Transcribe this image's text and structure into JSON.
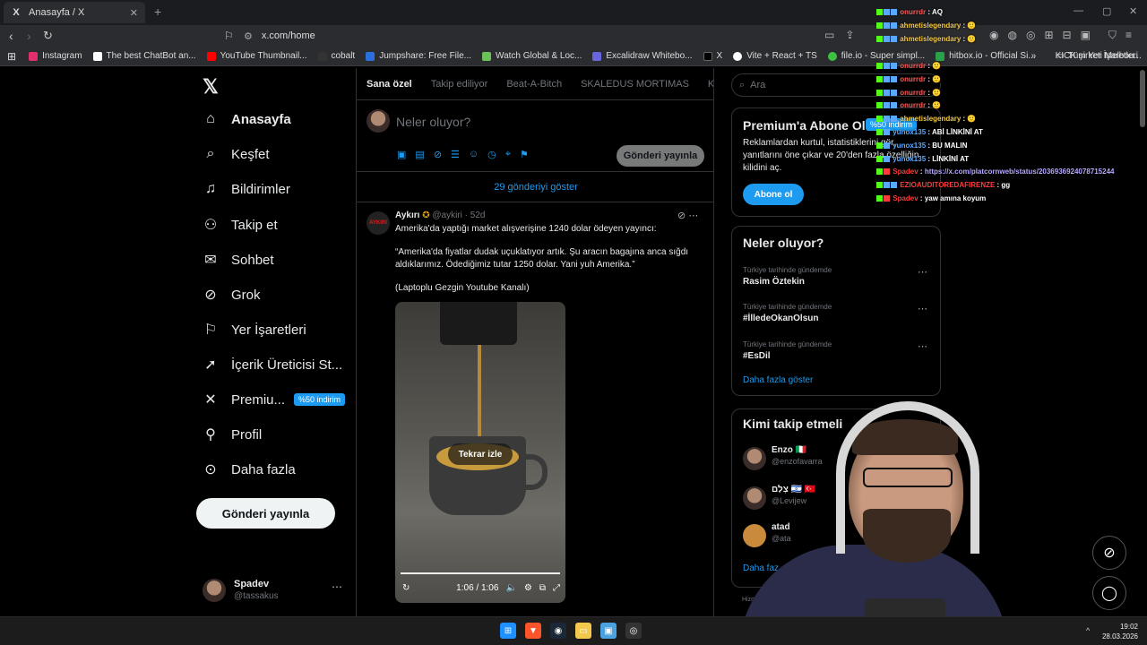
{
  "browser": {
    "tab_title": "Anasayfa / X",
    "tab_icon": "X",
    "url": "x.com/home",
    "bookmarks": [
      {
        "label": "Instagram",
        "color": "#e1306c"
      },
      {
        "label": "The best ChatBot an...",
        "color": "#ffffff"
      },
      {
        "label": "YouTube Thumbnail...",
        "color": "#ff0000"
      },
      {
        "label": "cobalt",
        "color": "#333333"
      },
      {
        "label": "Jumpshare: Free File...",
        "color": "#2a6fdb"
      },
      {
        "label": "Watch Global & Loc...",
        "color": "#6ac259"
      },
      {
        "label": "Excalidraw Whitebo...",
        "color": "#6965db"
      },
      {
        "label": "X",
        "color": "#000000"
      },
      {
        "label": "Vite + React + TS",
        "color": "#ffffff"
      },
      {
        "label": "file.io - Super simpl...",
        "color": "#3fbf3f"
      },
      {
        "label": "hitbox.io - Official Si...",
        "color": "#2aa04a"
      },
      {
        "label": "KICK şirketi Melbou...",
        "color": "#53fc18"
      }
    ],
    "all_bookmarks": "Tüm Yer İşaretleri"
  },
  "sidebar": {
    "items": [
      {
        "label": "Anasayfa",
        "icon": "⌂"
      },
      {
        "label": "Keşfet",
        "icon": "⌕"
      },
      {
        "label": "Bildirimler",
        "icon": "🔔"
      },
      {
        "label": "Takip et",
        "icon": "👤"
      },
      {
        "label": "Sohbet",
        "icon": "✉"
      },
      {
        "label": "Grok",
        "icon": "⊘"
      },
      {
        "label": "Yer İşaretleri",
        "icon": "⚐"
      },
      {
        "label": "İçerik Üreticisi St...",
        "icon": "➚"
      },
      {
        "label": "Premiu...",
        "icon": "X"
      },
      {
        "label": "Profil",
        "icon": "👤"
      },
      {
        "label": "Daha fazla",
        "icon": "⋯"
      }
    ],
    "premium_badge": "%50 indirim",
    "post_button": "Gönderi yayınla",
    "user": {
      "name": "Spadev",
      "handle": "@tassakus"
    }
  },
  "feed": {
    "tabs": [
      "Sana özel",
      "Takip ediliyor",
      "Beat-A-Bitch",
      "SKALEDUS MORTIMAS",
      "Kend"
    ],
    "compose_placeholder": "Neler oluyor?",
    "compose_button": "Gönderi yayınla",
    "show_posts": "29 gönderiyi göster",
    "tweet": {
      "author": "Aykırı",
      "avatar_text": "AYKIRI",
      "handle": "@aykiri",
      "time": "52d",
      "line1": "Amerika'da yaptığı market alışverişine 1240 dolar ödeyen yayıncı:",
      "line2": "“Amerika'da fiyatlar dudak uçuklatıyor artık. Şu aracın bagajına anca sığdı aldıklarımız. Ödediğimiz tutar 1250 dolar. Yani yuh Amerika.”",
      "line3": "(Laptoplu Gezgin Youtube Kanalı)",
      "replay": "Tekrar izle",
      "video_time": "1:06 / 1:06"
    }
  },
  "right": {
    "search_placeholder": "Ara",
    "premium": {
      "title": "Premium'a Abone Ol",
      "badge": "%50 indirim",
      "desc": "Reklamlardan kurtul, istatistiklerini gör, yanıtlarını öne çıkar ve 20'den fazla özelliğin kilidini aç.",
      "button": "Abone ol"
    },
    "trends": {
      "title": "Neler oluyor?",
      "items": [
        {
          "context": "Türkiye tarihinde gündemde",
          "topic": "Rasim Öztekin"
        },
        {
          "context": "Türkiye tarihinde gündemde",
          "topic": "#İlledeOkanOlsun"
        },
        {
          "context": "Türkiye tarihinde gündemde",
          "topic": "#EsDil"
        }
      ],
      "more": "Daha fazla göster"
    },
    "who_to_follow": {
      "title": "Kimi takip etmeli",
      "items": [
        {
          "name": "Enzo 🇮🇹",
          "handle": "@enzofavarra"
        },
        {
          "name": "צְלַם 🇮🇱 🇹🇷",
          "handle": "@Levijew"
        },
        {
          "name": "atad",
          "handle": "@ata"
        }
      ],
      "more": "Daha faz"
    },
    "footer": "Hizmet"
  },
  "chat": {
    "messages": [
      {
        "user": "onurrdr",
        "text": "AQ",
        "color": "#ff5a5a"
      },
      {
        "user": "ahmetislegendary",
        "text": "🙂",
        "color": "#f5c842"
      },
      {
        "user": "ahmetislegendary",
        "text": "🙂",
        "color": "#f5c842"
      },
      {
        "user": "onurrdr",
        "text": "🙂",
        "color": "#ff5a5a"
      },
      {
        "user": "onurrdr",
        "text": "🙂",
        "color": "#ff5a5a"
      },
      {
        "user": "onurrdr",
        "text": "🙂",
        "color": "#ff5a5a"
      },
      {
        "user": "onurrdr",
        "text": "🙂",
        "color": "#ff5a5a"
      },
      {
        "user": "ahmetislegendary",
        "text": "🙂",
        "color": "#f5c842"
      },
      {
        "user": "yunox135",
        "text": "ABİ LİNKİNİ AT",
        "color": "#5aa9ff"
      },
      {
        "user": "yunox135",
        "text": "BU MALIN",
        "color": "#5aa9ff"
      },
      {
        "user": "yunox135",
        "text": "LİNKİNİ AT",
        "color": "#5aa9ff"
      },
      {
        "user": "Spadev",
        "text": "https://x.com/platcornweb/status/2036936924078715244",
        "color": "#ff3b3b"
      },
      {
        "user": "EZIOAUDITOREDAFIRENZE",
        "text": "gg",
        "color": "#ff3b3b"
      },
      {
        "user": "Spadev",
        "text": "yaw amına koyum",
        "color": "#ff3b3b"
      }
    ]
  },
  "taskbar": {
    "time": "19:02",
    "date": "28.03.2026"
  }
}
